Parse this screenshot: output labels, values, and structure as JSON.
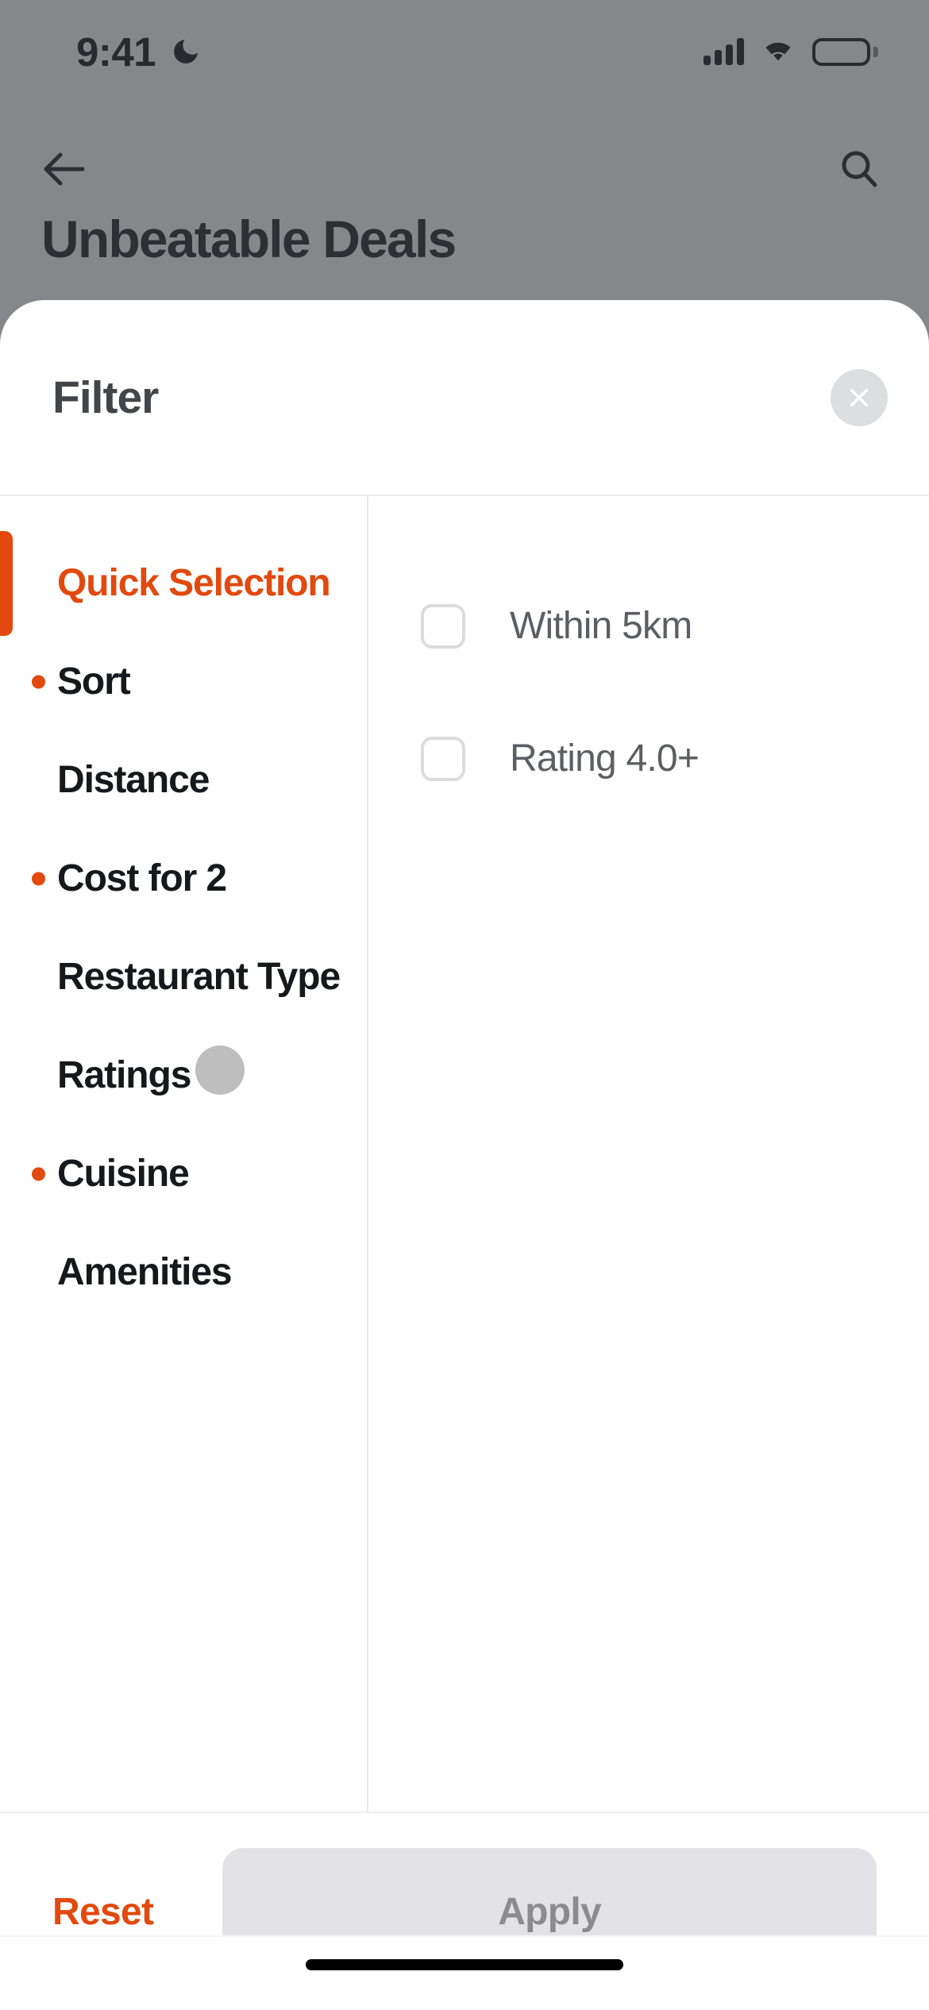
{
  "status_bar": {
    "time": "9:41",
    "moon_icon": "crescent-moon-icon",
    "signal_icon": "cellular-signal-icon",
    "wifi_icon": "wifi-icon",
    "battery_icon": "battery-full-icon"
  },
  "background_page": {
    "back_icon": "arrow-left-icon",
    "search_icon": "search-icon",
    "title": "Unbeatable Deals"
  },
  "sheet": {
    "title": "Filter",
    "close_icon": "close-x-icon"
  },
  "categories": [
    {
      "label": "Quick Selection",
      "active": true,
      "has_dot": false,
      "ripple": false
    },
    {
      "label": "Sort",
      "active": false,
      "has_dot": true,
      "ripple": false
    },
    {
      "label": "Distance",
      "active": false,
      "has_dot": false,
      "ripple": false
    },
    {
      "label": "Cost for 2",
      "active": false,
      "has_dot": true,
      "ripple": false
    },
    {
      "label": "Restaurant Type",
      "active": false,
      "has_dot": false,
      "ripple": false
    },
    {
      "label": "Ratings",
      "active": false,
      "has_dot": false,
      "ripple": true
    },
    {
      "label": "Cuisine",
      "active": false,
      "has_dot": true,
      "ripple": false
    },
    {
      "label": "Amenities",
      "active": false,
      "has_dot": false,
      "ripple": false
    }
  ],
  "options": [
    {
      "label": "Within 5km",
      "checked": false
    },
    {
      "label": "Rating 4.0+",
      "checked": false
    }
  ],
  "footer": {
    "reset_label": "Reset",
    "apply_label": "Apply",
    "apply_disabled": true
  },
  "colors": {
    "accent_orange": "#e2490e",
    "dim_overlay": "#636467",
    "apply_bg": "#e3e3e7",
    "apply_text": "#8b8b90",
    "option_text": "#5c5e63",
    "title_text": "#43454a"
  }
}
